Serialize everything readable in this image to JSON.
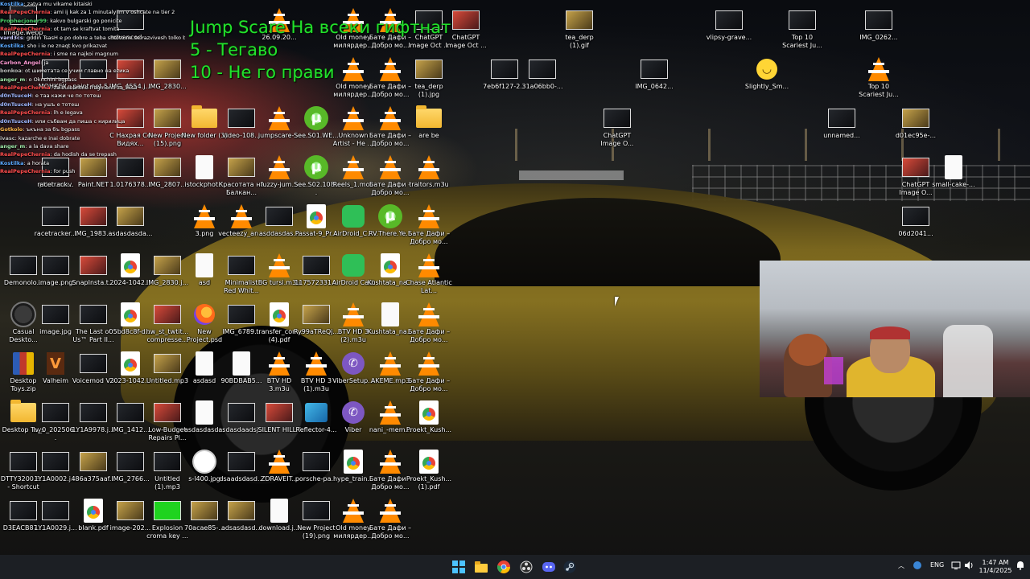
{
  "overlay_text": {
    "line1": "Jump Scare На всеки гифтнат",
    "line2": "5 - Тегаво",
    "line3": "10 - Не го прави"
  },
  "chat": [
    {
      "user": "Kostilka",
      "text": ": zatva mu vikame kitaiski",
      "color": "#5aa9ff"
    },
    {
      "user": "RealPepeChernia",
      "text": ": ami ij kak za 1 minutalyiim v oshcate na tier 2",
      "color": "#ff4d4d"
    },
    {
      "user": "Prophecjoner99",
      "text": ": kakvo bulgarski go ponicite",
      "color": "#49d36a"
    },
    {
      "user": "RealPepeChernia",
      "text": ": ot tam se kraftvat tomita",
      "color": "#ff4d4d"
    },
    {
      "user": "vard3cs",
      "text": ": gddin TsasH e po dobre a teba shtoto ne se razvivesh tolko burzo",
      "color": "#c9c9ff"
    },
    {
      "user": "Kostilka",
      "text": ": sho i ie ne znaqt kvo prikazvat",
      "color": "#5aa9ff"
    },
    {
      "user": "RealPepeChernia",
      "text": ": i sme na najkoi magnum",
      "color": "#ff4d4d"
    },
    {
      "user": "Carbon_Angel",
      "text": ": ja",
      "color": "#ff9ad5"
    },
    {
      "user": "bonkoa",
      "text": ": ot шиметата се учим главно на ezика",
      "color": "#bbbbbb"
    },
    {
      "user": "anger_m",
      "text": ": o Oknchini bgpass",
      "color": "#9fe8a8"
    },
    {
      "user": "RealPepeChernia",
      "text": ": za bulbaritne fragmenti za 1ksa",
      "color": "#ff4d4d"
    },
    {
      "user": "d0nTsuceH",
      "text": ": e таа кажи че по тотеш",
      "color": "#9fb7ff"
    },
    {
      "user": "d0nTsuceH",
      "text": ": на ушъ е тотеш",
      "color": "#9fb7ff"
    },
    {
      "user": "RealPepeChernia",
      "text": ": lh e Iegava",
      "color": "#ff4d4d"
    },
    {
      "user": "d0nTsuceH",
      "text": ": или събвам да пиша с кирилица",
      "color": "#9fb7ff"
    },
    {
      "user": "Gotkolo",
      "text": ": ъкъна за бъ bgpass",
      "color": "#ffb84d"
    },
    {
      "user": "ivasc",
      "text": ": kazarche e inai dobrate",
      "color": "#bbbbbb"
    },
    {
      "user": "anger_m",
      "text": ": a la dava share",
      "color": "#9fe8a8"
    },
    {
      "user": "RealPepeChernia",
      "text": ": da hodish da se trepash",
      "color": "#ff4d4d"
    },
    {
      "user": "Kostilka",
      "text": ": a horata",
      "color": "#5aa9ff"
    },
    {
      "user": "RealPepeChernia",
      "text": ": for push",
      "color": "#ff4d4d"
    }
  ],
  "desktop_icons": [
    {
      "label": "advanced-...",
      "type": "img",
      "variant": "dark"
    },
    {
      "label": "26.09.20...",
      "type": "vlc"
    },
    {
      "label": "Old money милярдер...",
      "type": "vlc"
    },
    {
      "label": "Бате Дафи – Добро мо...",
      "type": "vlc"
    },
    {
      "label": "ChatGPT Image Oct ...",
      "type": "img",
      "variant": "dark"
    },
    {
      "label": "ChatGPT Image Oct ...",
      "type": "img",
      "variant": "red"
    },
    {
      "label": "IMG_4554.j...",
      "type": "img",
      "variant": "red"
    },
    {
      "label": "IMG_2830...",
      "type": "img",
      "variant": "warm"
    },
    {
      "label": "МОНКЕУ...",
      "type": "img",
      "variant": "dark"
    },
    {
      "label": "paint.net.5...",
      "type": "img",
      "variant": "dark"
    },
    {
      "label": "Old money милярдер...",
      "type": "vlc"
    },
    {
      "label": "Бате Дафи – Добро мо...",
      "type": "vlc"
    },
    {
      "label": "tea_derp (1).jpg",
      "type": "img",
      "variant": "warm"
    },
    {
      "label": "С Нахрая Се Видях...",
      "type": "img",
      "variant": "red"
    },
    {
      "label": "New Project (15).png",
      "type": "img",
      "variant": "warm"
    },
    {
      "label": "New folder (3)",
      "type": "folder"
    },
    {
      "label": "video-108...",
      "type": "img",
      "variant": "dark"
    },
    {
      "label": "jumpscare-...",
      "type": "vlc"
    },
    {
      "label": "See.S01.WE...",
      "type": "ut"
    },
    {
      "label": "Unknown Artist - Не ...",
      "type": "vlc"
    },
    {
      "label": "Бате Дафи – Добро мо...",
      "type": "vlc"
    },
    {
      "label": "are be",
      "type": "folder"
    },
    {
      "label": "ption.mov",
      "type": "img",
      "variant": "dark"
    },
    {
      "label": "racetrack...",
      "type": "img",
      "variant": "dark"
    },
    {
      "label": "Paint.NET",
      "type": "img",
      "variant": "warm"
    },
    {
      "label": "1.0176378...",
      "type": "img",
      "variant": "dark"
    },
    {
      "label": "IMG_2807...",
      "type": "img",
      "variant": "warm"
    },
    {
      "label": "istockphot...",
      "type": "file"
    },
    {
      "label": "Красотата на Балкан...",
      "type": "img",
      "variant": "warm"
    },
    {
      "label": "fuzzy-jum...",
      "type": "vlc"
    },
    {
      "label": "See.S02.108...",
      "type": "ut"
    },
    {
      "label": "Reels_1.mov",
      "type": "vlc"
    },
    {
      "label": "Бате Дафи – Добро мо...",
      "type": "vlc"
    },
    {
      "label": "traitors.m3u",
      "type": "vlc"
    },
    {
      "label": "racetracker...",
      "type": "img",
      "variant": "dark"
    },
    {
      "label": "IMG_1983...",
      "type": "img",
      "variant": "red"
    },
    {
      "label": "asdasdasda...",
      "type": "img",
      "variant": "warm"
    },
    {
      "label": "3.png",
      "type": "vlc"
    },
    {
      "label": "vecteezy_an...",
      "type": "vlc"
    },
    {
      "label": "asddasdas...",
      "type": "img",
      "variant": "dark"
    },
    {
      "label": "Passat-9_Pr...",
      "type": "pdf"
    },
    {
      "label": "AirDroid_C...",
      "type": "airdroid"
    },
    {
      "label": "RV.There.Ye...",
      "type": "ut"
    },
    {
      "label": "Бате Дафи – Добро мо...",
      "type": "vlc"
    },
    {
      "label": "Demonolo...",
      "type": "img",
      "variant": "dark"
    },
    {
      "label": "image.png",
      "type": "img",
      "variant": "dark"
    },
    {
      "label": "SnapInsta.t...",
      "type": "img",
      "variant": "red"
    },
    {
      "label": "2024-1042...",
      "type": "pdf"
    },
    {
      "label": "IMG_2830.j...",
      "type": "img",
      "variant": "warm"
    },
    {
      "label": "asd",
      "type": "file"
    },
    {
      "label": "Minimalist Red Whit...",
      "type": "img",
      "variant": "dark"
    },
    {
      "label": "BG tursi.m3u",
      "type": "vlc"
    },
    {
      "label": "117572331...",
      "type": "img",
      "variant": "dark"
    },
    {
      "label": "AirDroid Cast",
      "type": "airdroid"
    },
    {
      "label": "Kushtata_na...",
      "type": "pdf"
    },
    {
      "label": "Chase Atlantic Lat...",
      "type": "vlc"
    },
    {
      "label": "Casual Deskto...",
      "type": "gauge"
    },
    {
      "label": "image.jpg",
      "type": "img",
      "variant": "dark"
    },
    {
      "label": "The Last of Us™ Part II...",
      "type": "img",
      "variant": "dark"
    },
    {
      "label": "05bd8c8f-d...",
      "type": "pdf"
    },
    {
      "label": "hw_st_twtit... compresse...",
      "type": "img",
      "variant": "red"
    },
    {
      "label": "New Project.psd",
      "type": "firefox"
    },
    {
      "label": "IMG_6789...",
      "type": "img",
      "variant": "dark"
    },
    {
      "label": "transfer_con... (4).pdf",
      "type": "pdf"
    },
    {
      "label": "Ry99aTReQj...",
      "type": "img",
      "variant": "warm"
    },
    {
      "label": "BTV HD 3 (2).m3u",
      "type": "vlc"
    },
    {
      "label": "Kushtata_na...",
      "type": "file"
    },
    {
      "label": "Бате Дафи – Добро мо...",
      "type": "vlc"
    },
    {
      "label": "Desktop Toys.zip",
      "type": "zip"
    },
    {
      "label": "Valheim",
      "type": "valheim"
    },
    {
      "label": "Voicemod V3",
      "type": "img",
      "variant": "dark"
    },
    {
      "label": "2023-1042...",
      "type": "pdf"
    },
    {
      "label": "Untitled.mp3",
      "type": "img",
      "variant": "warm"
    },
    {
      "label": "asdasd",
      "type": "file"
    },
    {
      "label": "90BDBAB5...",
      "type": "file"
    },
    {
      "label": "BTV HD 3.m3u",
      "type": "vlc"
    },
    {
      "label": "BTV HD 3 (1).m3u",
      "type": "vlc"
    },
    {
      "label": "ViberSetup...",
      "type": "viber"
    },
    {
      "label": "AKEME.mp3",
      "type": "vlc"
    },
    {
      "label": "Бате Дафи – Добро мо...",
      "type": "vlc"
    },
    {
      "label": "Desktop Toys",
      "type": "folder"
    },
    {
      "label": "lv_0_202506...",
      "type": "img",
      "variant": "dark"
    },
    {
      "label": "1Y1A9978.j...",
      "type": "img",
      "variant": "dark"
    },
    {
      "label": "IMG_1412...",
      "type": "img",
      "variant": "dark"
    },
    {
      "label": "Low-Budget Repairs Pl...",
      "type": "img",
      "variant": "red"
    },
    {
      "label": "asdasdasd...",
      "type": "file"
    },
    {
      "label": "asdasdaadsj...",
      "type": "img",
      "variant": "dark"
    },
    {
      "label": "SILENT HILL f",
      "type": "img",
      "variant": "red"
    },
    {
      "label": "Reflector-4...",
      "type": "reflector"
    },
    {
      "label": "Viber",
      "type": "viber"
    },
    {
      "label": "nani_-mem...",
      "type": "vlc"
    },
    {
      "label": "Proekt_Kush...",
      "type": "pdf"
    },
    {
      "label": "DTTY3200.E... - Shortcut",
      "type": "img",
      "variant": "dark"
    },
    {
      "label": "1Y1A0002.j...",
      "type": "img",
      "variant": "dark"
    },
    {
      "label": "486a375aaf...",
      "type": "img",
      "variant": "warm"
    },
    {
      "label": "IMG_2766...",
      "type": "img",
      "variant": "dark"
    },
    {
      "label": "Untitled (1).mp3",
      "type": "img",
      "variant": "dark"
    },
    {
      "label": "s-l400.jpg",
      "type": "mercedes"
    },
    {
      "label": "dsaadsdasd...",
      "type": "img",
      "variant": "dark"
    },
    {
      "label": "ZDRAVEIT...",
      "type": "vlc"
    },
    {
      "label": "porsche-pa...",
      "type": "img",
      "variant": "dark"
    },
    {
      "label": "hype_train...",
      "type": "pdf"
    },
    {
      "label": "Бате Дафи – Добро мо...",
      "type": "vlc"
    },
    {
      "label": "Proekt_Kush... (1).pdf",
      "type": "pdf"
    },
    {
      "label": "D3EACB87...",
      "type": "img",
      "variant": "dark"
    },
    {
      "label": "1Y1A0029.j...",
      "type": "img",
      "variant": "dark"
    },
    {
      "label": "blank.pdf",
      "type": "pdf"
    },
    {
      "label": "image-202...",
      "type": "img",
      "variant": "warm"
    },
    {
      "label": "Explosion croma key ...",
      "type": "img",
      "variant": "green"
    },
    {
      "label": "70acae85-...",
      "type": "img",
      "variant": "warm"
    },
    {
      "label": "adsasdasd...",
      "type": "img",
      "variant": "warm"
    },
    {
      "label": "download.j...",
      "type": "file"
    },
    {
      "label": "New Project (19).png",
      "type": "img",
      "variant": "dark"
    },
    {
      "label": "Old money милярдер...",
      "type": "vlc"
    },
    {
      "label": "Бате Дафи – Добро мо...",
      "type": "vlc"
    },
    {
      "label": "tea_derp (1).gif",
      "type": "img",
      "variant": "warm"
    },
    {
      "label": "vlipsy-grave...",
      "type": "img",
      "variant": "dark"
    },
    {
      "label": "Top 10 Scariest Ju...",
      "type": "img",
      "variant": "dark"
    },
    {
      "label": "IMG_0262...",
      "type": "img",
      "variant": "dark"
    },
    {
      "label": "7eb6f127-2...",
      "type": "img",
      "variant": "dark"
    },
    {
      "label": "31a06bb0-...",
      "type": "img",
      "variant": "dark"
    },
    {
      "label": "IMG_0642...",
      "type": "img",
      "variant": "dark"
    },
    {
      "label": "Slightly_Sm...",
      "type": "emoji"
    },
    {
      "label": "Top 10 Scariest Ju...",
      "type": "vlc"
    },
    {
      "label": "ChatGPT Image O...",
      "type": "img",
      "variant": "dark"
    },
    {
      "label": "unnamed...",
      "type": "img",
      "variant": "dark"
    },
    {
      "label": "d01ec95e-...",
      "type": "img",
      "variant": "warm"
    },
    {
      "label": "ChatGPT Image O...",
      "type": "img",
      "variant": "red"
    },
    {
      "label": "small-cake-...",
      "type": "file"
    },
    {
      "label": "06d2041...",
      "type": "img",
      "variant": "dark"
    },
    {
      "label": "image.webp",
      "type": "img",
      "variant": "dark"
    }
  ],
  "taskbar": {
    "apps": [
      "start",
      "file-explorer",
      "chrome",
      "obs",
      "discord",
      "steam"
    ],
    "language": "ENG",
    "time": "1:47 AM",
    "date": "11/4/2025"
  }
}
